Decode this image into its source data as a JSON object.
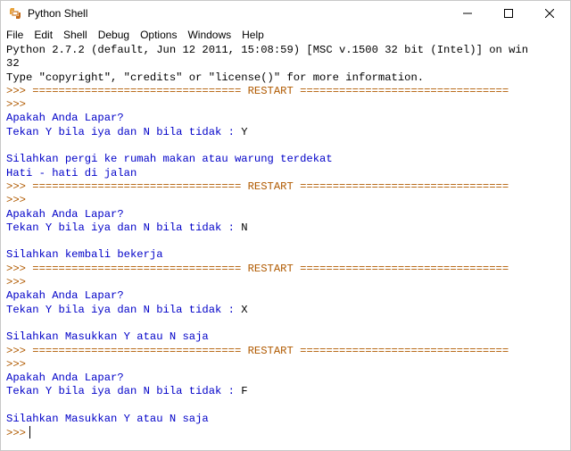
{
  "window": {
    "title": "Python Shell"
  },
  "menu": [
    {
      "label": "File",
      "name": "menu-file"
    },
    {
      "label": "Edit",
      "name": "menu-edit"
    },
    {
      "label": "Shell",
      "name": "menu-shell"
    },
    {
      "label": "Debug",
      "name": "menu-debug"
    },
    {
      "label": "Options",
      "name": "menu-options"
    },
    {
      "label": "Windows",
      "name": "menu-windows"
    },
    {
      "label": "Help",
      "name": "menu-help"
    }
  ],
  "colors": {
    "prompt": "#b05a00",
    "stdout": "#0000c8",
    "text": "#000000"
  },
  "shell": {
    "banner_line1": "Python 2.7.2 (default, Jun 12 2011, 15:08:59) [MSC v.1500 32 bit (Intel)] on win",
    "banner_line2": "32",
    "banner_line3": "Type \"copyright\", \"credits\" or \"license()\" for more information.",
    "prompt": ">>>",
    "restart": " ================================ RESTART ================================",
    "question": "Apakah Anda Lapar?",
    "ask": "Tekan Y bila iya dan N bila tidak : ",
    "runs": [
      {
        "answer": "Y",
        "responses": [
          "Silahkan pergi ke rumah makan atau warung terdekat",
          "Hati - hati di jalan"
        ]
      },
      {
        "answer": "N",
        "responses": [
          "Silahkan kembali bekerja"
        ]
      },
      {
        "answer": "X",
        "responses": [
          "Silahkan Masukkan Y atau N saja"
        ]
      },
      {
        "answer": "F",
        "responses": [
          "Silahkan Masukkan Y atau N saja"
        ]
      }
    ]
  }
}
